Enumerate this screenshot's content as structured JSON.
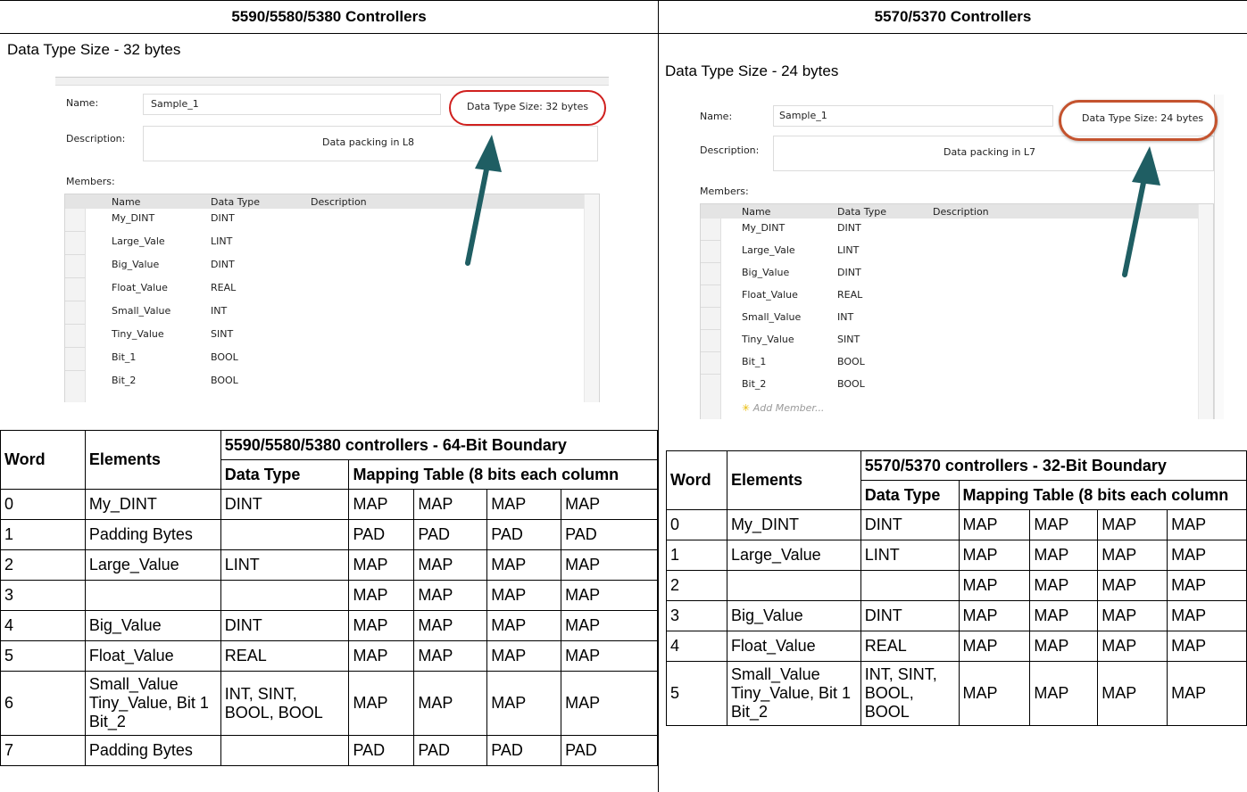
{
  "headers": {
    "left": "5590/5580/5380 Controllers",
    "right": "5570/5370 Controllers"
  },
  "left": {
    "caption": "Data Type Size - 32 bytes",
    "shot": {
      "name_label": "Name:",
      "name_value": "Sample_1",
      "desc_label": "Description:",
      "desc_value": "Data packing in L8",
      "size_text": "Data Type Size: 32 bytes",
      "members_label": "Members:",
      "col_name": "Name",
      "col_type": "Data Type",
      "col_desc": "Description",
      "members": [
        {
          "name": "My_DINT",
          "type": "DINT"
        },
        {
          "name": "Large_Vale",
          "type": "LINT"
        },
        {
          "name": "Big_Value",
          "type": "DINT"
        },
        {
          "name": "Float_Value",
          "type": "REAL"
        },
        {
          "name": "Small_Value",
          "type": "INT"
        },
        {
          "name": "Tiny_Value",
          "type": "SINT"
        },
        {
          "name": "Bit_1",
          "type": "BOOL"
        },
        {
          "name": "Bit_2",
          "type": "BOOL"
        }
      ]
    },
    "table": {
      "h_word": "Word",
      "h_elements": "Elements",
      "h_group": "5590/5580/5380 controllers - 64-Bit Boundary",
      "h_type": "Data Type",
      "h_map": "Mapping Table (8 bits each column",
      "rows": [
        {
          "word": "0",
          "el": "My_DINT",
          "type": "DINT",
          "m": [
            "MAP",
            "MAP",
            "MAP",
            "MAP"
          ]
        },
        {
          "word": "1",
          "el": "Padding Bytes",
          "type": "",
          "m": [
            "PAD",
            "PAD",
            "PAD",
            "PAD"
          ]
        },
        {
          "word": "2",
          "el": "Large_Value",
          "type": "LINT",
          "m": [
            "MAP",
            "MAP",
            "MAP",
            "MAP"
          ]
        },
        {
          "word": "3",
          "el": "",
          "type": "",
          "m": [
            "MAP",
            "MAP",
            "MAP",
            "MAP"
          ]
        },
        {
          "word": "4",
          "el": "Big_Value",
          "type": "DINT",
          "m": [
            "MAP",
            "MAP",
            "MAP",
            "MAP"
          ]
        },
        {
          "word": "5",
          "el": "Float_Value",
          "type": "REAL",
          "m": [
            "MAP",
            "MAP",
            "MAP",
            "MAP"
          ]
        },
        {
          "word": "6",
          "el": "Small_Value Tiny_Value, Bit 1 Bit_2",
          "type": "INT, SINT, BOOL, BOOL",
          "m": [
            "MAP",
            "MAP",
            "MAP",
            "MAP"
          ]
        },
        {
          "word": "7",
          "el": "Padding Bytes",
          "type": "",
          "m": [
            "PAD",
            "PAD",
            "PAD",
            "PAD"
          ]
        }
      ]
    }
  },
  "right": {
    "caption": "Data Type Size - 24 bytes",
    "shot": {
      "name_label": "Name:",
      "name_value": "Sample_1",
      "desc_label": "Description:",
      "desc_value": "Data packing in L7",
      "size_text": "Data Type Size: 24 bytes",
      "members_label": "Members:",
      "col_name": "Name",
      "col_type": "Data Type",
      "col_desc": "Description",
      "members": [
        {
          "name": "My_DINT",
          "type": "DINT"
        },
        {
          "name": "Large_Vale",
          "type": "LINT"
        },
        {
          "name": "Big_Value",
          "type": "DINT"
        },
        {
          "name": "Float_Value",
          "type": "REAL"
        },
        {
          "name": "Small_Value",
          "type": "INT"
        },
        {
          "name": "Tiny_Value",
          "type": "SINT"
        },
        {
          "name": "Bit_1",
          "type": "BOOL"
        },
        {
          "name": "Bit_2",
          "type": "BOOL"
        }
      ],
      "add_member": "Add Member..."
    },
    "table": {
      "h_word": "Word",
      "h_elements": "Elements",
      "h_group": "5570/5370 controllers - 32-Bit Boundary",
      "h_type": "Data Type",
      "h_map": "Mapping Table (8 bits each column",
      "rows": [
        {
          "word": "0",
          "el": "My_DINT",
          "type": "DINT",
          "m": [
            "MAP",
            "MAP",
            "MAP",
            "MAP"
          ]
        },
        {
          "word": "1",
          "el": "Large_Value",
          "type": "LINT",
          "m": [
            "MAP",
            "MAP",
            "MAP",
            "MAP"
          ]
        },
        {
          "word": "2",
          "el": "",
          "type": "",
          "m": [
            "MAP",
            "MAP",
            "MAP",
            "MAP"
          ]
        },
        {
          "word": "3",
          "el": "Big_Value",
          "type": "DINT",
          "m": [
            "MAP",
            "MAP",
            "MAP",
            "MAP"
          ]
        },
        {
          "word": "4",
          "el": "Float_Value",
          "type": "REAL",
          "m": [
            "MAP",
            "MAP",
            "MAP",
            "MAP"
          ]
        },
        {
          "word": "5",
          "el": "Small_Value Tiny_Value, Bit 1 Bit_2",
          "type": "INT, SINT, BOOL, BOOL",
          "m": [
            "MAP",
            "MAP",
            "MAP",
            "MAP"
          ]
        }
      ]
    }
  }
}
